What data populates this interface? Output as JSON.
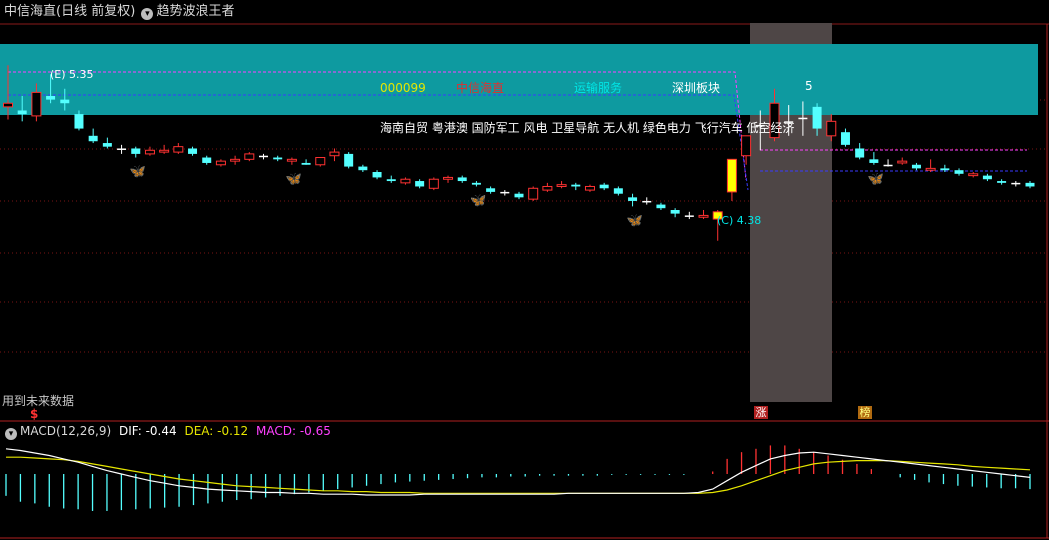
{
  "header": {
    "stock_name": "中信海直",
    "period_label": "(日线 前复权)",
    "indicator_label": "趋势波浪王者"
  },
  "banner": {
    "code": "000099",
    "name": "中信海直",
    "industry": "运输服务",
    "board": "深圳板块",
    "concepts": "海南自贸 粤港澳 国防军工 风电 卫星导航 无人机 绿色电力 飞行汽车 低空经济",
    "colors": {
      "bg": "#0e9aa0",
      "code": "#e6e600",
      "name": "#e03030",
      "industry": "#00e6e6",
      "board": "#ffffff"
    }
  },
  "annotations": {
    "high_label": "(E) 5.35",
    "low_label": "(C) 4.38",
    "peak_label": "5",
    "future_note": "用到未来数据",
    "marker_s": "$",
    "marker_zhang": "涨",
    "marker_bang": "榜"
  },
  "macd": {
    "label": "MACD(12,26,9)",
    "dif": "DIF: -0.44",
    "dea": "DEA: -0.12",
    "macd": "MACD: -0.65",
    "colors": {
      "dif": "#ffffff",
      "dea": "#e6e600",
      "macd": "#ff40ff"
    }
  },
  "chart_data": {
    "type": "candlestick",
    "price_range": [
      3.5,
      5.6
    ],
    "colors": {
      "up": "#ff3232",
      "down": "#54ffff",
      "doji": "#ffffff",
      "limit_up": "#ffff00"
    },
    "candles": [
      {
        "o": 5.12,
        "h": 5.35,
        "l": 5.05,
        "c": 5.14
      },
      {
        "o": 5.1,
        "h": 5.18,
        "l": 5.04,
        "c": 5.08
      },
      {
        "o": 5.07,
        "h": 5.25,
        "l": 5.04,
        "c": 5.2
      },
      {
        "o": 5.18,
        "h": 5.3,
        "l": 5.14,
        "c": 5.16
      },
      {
        "o": 5.16,
        "h": 5.22,
        "l": 5.1,
        "c": 5.14
      },
      {
        "o": 5.08,
        "h": 5.1,
        "l": 4.99,
        "c": 5.0
      },
      {
        "o": 4.96,
        "h": 5.0,
        "l": 4.92,
        "c": 4.93
      },
      {
        "o": 4.92,
        "h": 4.95,
        "l": 4.89,
        "c": 4.9
      },
      {
        "o": 4.89,
        "h": 4.91,
        "l": 4.86,
        "c": 4.89
      },
      {
        "o": 4.89,
        "h": 4.9,
        "l": 4.84,
        "c": 4.86
      },
      {
        "o": 4.86,
        "h": 4.9,
        "l": 4.85,
        "c": 4.88
      },
      {
        "o": 4.87,
        "h": 4.91,
        "l": 4.86,
        "c": 4.88
      },
      {
        "o": 4.87,
        "h": 4.92,
        "l": 4.86,
        "c": 4.9
      },
      {
        "o": 4.89,
        "h": 4.9,
        "l": 4.85,
        "c": 4.86
      },
      {
        "o": 4.84,
        "h": 4.85,
        "l": 4.8,
        "c": 4.81
      },
      {
        "o": 4.8,
        "h": 4.83,
        "l": 4.79,
        "c": 4.82
      },
      {
        "o": 4.82,
        "h": 4.85,
        "l": 4.8,
        "c": 4.83
      },
      {
        "o": 4.83,
        "h": 4.87,
        "l": 4.82,
        "c": 4.86
      },
      {
        "o": 4.85,
        "h": 4.86,
        "l": 4.83,
        "c": 4.85
      },
      {
        "o": 4.84,
        "h": 4.85,
        "l": 4.82,
        "c": 4.83
      },
      {
        "o": 4.82,
        "h": 4.84,
        "l": 4.8,
        "c": 4.83
      },
      {
        "o": 4.81,
        "h": 4.83,
        "l": 4.8,
        "c": 4.8
      },
      {
        "o": 4.8,
        "h": 4.84,
        "l": 4.79,
        "c": 4.84
      },
      {
        "o": 4.85,
        "h": 4.89,
        "l": 4.82,
        "c": 4.87
      },
      {
        "o": 4.86,
        "h": 4.87,
        "l": 4.78,
        "c": 4.79
      },
      {
        "o": 4.79,
        "h": 4.8,
        "l": 4.76,
        "c": 4.77
      },
      {
        "o": 4.76,
        "h": 4.77,
        "l": 4.72,
        "c": 4.73
      },
      {
        "o": 4.72,
        "h": 4.74,
        "l": 4.7,
        "c": 4.71
      },
      {
        "o": 4.7,
        "h": 4.73,
        "l": 4.69,
        "c": 4.72
      },
      {
        "o": 4.71,
        "h": 4.72,
        "l": 4.67,
        "c": 4.68
      },
      {
        "o": 4.67,
        "h": 4.73,
        "l": 4.66,
        "c": 4.72
      },
      {
        "o": 4.72,
        "h": 4.74,
        "l": 4.7,
        "c": 4.73
      },
      {
        "o": 4.73,
        "h": 4.74,
        "l": 4.7,
        "c": 4.71
      },
      {
        "o": 4.7,
        "h": 4.71,
        "l": 4.68,
        "c": 4.69
      },
      {
        "o": 4.67,
        "h": 4.68,
        "l": 4.64,
        "c": 4.65
      },
      {
        "o": 4.65,
        "h": 4.66,
        "l": 4.63,
        "c": 4.65
      },
      {
        "o": 4.64,
        "h": 4.65,
        "l": 4.61,
        "c": 4.62
      },
      {
        "o": 4.61,
        "h": 4.68,
        "l": 4.6,
        "c": 4.67
      },
      {
        "o": 4.66,
        "h": 4.7,
        "l": 4.65,
        "c": 4.68
      },
      {
        "o": 4.68,
        "h": 4.71,
        "l": 4.67,
        "c": 4.69
      },
      {
        "o": 4.69,
        "h": 4.7,
        "l": 4.66,
        "c": 4.68
      },
      {
        "o": 4.66,
        "h": 4.69,
        "l": 4.65,
        "c": 4.68
      },
      {
        "o": 4.69,
        "h": 4.7,
        "l": 4.66,
        "c": 4.67
      },
      {
        "o": 4.67,
        "h": 4.68,
        "l": 4.63,
        "c": 4.64
      },
      {
        "o": 4.62,
        "h": 4.64,
        "l": 4.57,
        "c": 4.6
      },
      {
        "o": 4.6,
        "h": 4.62,
        "l": 4.58,
        "c": 4.6
      },
      {
        "o": 4.58,
        "h": 4.59,
        "l": 4.55,
        "c": 4.56
      },
      {
        "o": 4.55,
        "h": 4.56,
        "l": 4.51,
        "c": 4.53
      },
      {
        "o": 4.52,
        "h": 4.54,
        "l": 4.5,
        "c": 4.52
      },
      {
        "o": 4.51,
        "h": 4.55,
        "l": 4.5,
        "c": 4.52
      },
      {
        "o": 4.5,
        "h": 4.55,
        "l": 4.38,
        "c": 4.54
      },
      {
        "o": 4.65,
        "h": 4.83,
        "l": 4.6,
        "c": 4.83
      },
      {
        "o": 4.85,
        "h": 4.96,
        "l": 4.8,
        "c": 4.96
      },
      {
        "o": 5.02,
        "h": 5.1,
        "l": 4.88,
        "c": 5.02
      },
      {
        "o": 4.95,
        "h": 5.22,
        "l": 4.93,
        "c": 5.14
      },
      {
        "o": 5.04,
        "h": 5.13,
        "l": 4.96,
        "c": 5.04
      },
      {
        "o": 5.06,
        "h": 5.15,
        "l": 4.96,
        "c": 5.06
      },
      {
        "o": 5.12,
        "h": 5.14,
        "l": 4.96,
        "c": 5.0
      },
      {
        "o": 4.96,
        "h": 5.08,
        "l": 4.93,
        "c": 5.04
      },
      {
        "o": 4.98,
        "h": 5.0,
        "l": 4.9,
        "c": 4.91
      },
      {
        "o": 4.89,
        "h": 4.92,
        "l": 4.83,
        "c": 4.84
      },
      {
        "o": 4.83,
        "h": 4.87,
        "l": 4.8,
        "c": 4.81
      },
      {
        "o": 4.8,
        "h": 4.83,
        "l": 4.79,
        "c": 4.8
      },
      {
        "o": 4.81,
        "h": 4.84,
        "l": 4.8,
        "c": 4.82
      },
      {
        "o": 4.8,
        "h": 4.81,
        "l": 4.77,
        "c": 4.78
      },
      {
        "o": 4.77,
        "h": 4.83,
        "l": 4.76,
        "c": 4.78
      },
      {
        "o": 4.78,
        "h": 4.8,
        "l": 4.76,
        "c": 4.77
      },
      {
        "o": 4.77,
        "h": 4.78,
        "l": 4.74,
        "c": 4.75
      },
      {
        "o": 4.74,
        "h": 4.76,
        "l": 4.73,
        "c": 4.75
      },
      {
        "o": 4.74,
        "h": 4.75,
        "l": 4.71,
        "c": 4.72
      },
      {
        "o": 4.71,
        "h": 4.72,
        "l": 4.69,
        "c": 4.7
      },
      {
        "o": 4.7,
        "h": 4.71,
        "l": 4.68,
        "c": 4.7
      },
      {
        "o": 4.7,
        "h": 4.71,
        "l": 4.67,
        "c": 4.68
      }
    ],
    "macd_range": [
      -0.75,
      0.5
    ],
    "macd_hist": [
      -0.26,
      -0.33,
      -0.35,
      -0.39,
      -0.41,
      -0.42,
      -0.44,
      -0.44,
      -0.43,
      -0.42,
      -0.41,
      -0.4,
      -0.39,
      -0.37,
      -0.35,
      -0.33,
      -0.31,
      -0.3,
      -0.28,
      -0.26,
      -0.24,
      -0.22,
      -0.2,
      -0.18,
      -0.16,
      -0.14,
      -0.12,
      -0.1,
      -0.09,
      -0.08,
      -0.07,
      -0.06,
      -0.05,
      -0.04,
      -0.04,
      -0.03,
      -0.03,
      -0.02,
      -0.02,
      -0.02,
      -0.02,
      -0.02,
      -0.01,
      -0.01,
      -0.01,
      -0.01,
      -0.01,
      -0.01,
      0.0,
      0.03,
      0.18,
      0.26,
      0.3,
      0.34,
      0.34,
      0.3,
      0.26,
      0.22,
      0.17,
      0.12,
      0.06,
      0.0,
      -0.04,
      -0.07,
      -0.1,
      -0.12,
      -0.14,
      -0.15,
      -0.16,
      -0.17,
      -0.17,
      -0.18
    ],
    "dif": [
      0.3,
      0.28,
      0.25,
      0.22,
      0.18,
      0.14,
      0.09,
      0.04,
      0.0,
      -0.04,
      -0.08,
      -0.11,
      -0.14,
      -0.16,
      -0.18,
      -0.19,
      -0.2,
      -0.21,
      -0.22,
      -0.22,
      -0.23,
      -0.23,
      -0.24,
      -0.24,
      -0.24,
      -0.25,
      -0.25,
      -0.25,
      -0.25,
      -0.24,
      -0.24,
      -0.24,
      -0.24,
      -0.24,
      -0.24,
      -0.24,
      -0.24,
      -0.24,
      -0.24,
      -0.23,
      -0.23,
      -0.23,
      -0.23,
      -0.23,
      -0.23,
      -0.23,
      -0.23,
      -0.23,
      -0.22,
      -0.18,
      -0.08,
      0.02,
      0.1,
      0.18,
      0.22,
      0.25,
      0.26,
      0.24,
      0.22,
      0.2,
      0.18,
      0.16,
      0.14,
      0.12,
      0.1,
      0.08,
      0.06,
      0.04,
      0.02,
      0.0,
      -0.02,
      -0.04
    ],
    "dea": [
      0.2,
      0.2,
      0.19,
      0.18,
      0.17,
      0.15,
      0.12,
      0.09,
      0.06,
      0.03,
      0.0,
      -0.03,
      -0.06,
      -0.08,
      -0.1,
      -0.12,
      -0.14,
      -0.15,
      -0.16,
      -0.17,
      -0.18,
      -0.19,
      -0.2,
      -0.2,
      -0.21,
      -0.21,
      -0.22,
      -0.22,
      -0.22,
      -0.23,
      -0.23,
      -0.23,
      -0.23,
      -0.23,
      -0.23,
      -0.23,
      -0.23,
      -0.23,
      -0.23,
      -0.23,
      -0.23,
      -0.23,
      -0.23,
      -0.23,
      -0.23,
      -0.23,
      -0.23,
      -0.23,
      -0.23,
      -0.22,
      -0.19,
      -0.14,
      -0.08,
      -0.02,
      0.04,
      0.08,
      0.12,
      0.14,
      0.15,
      0.16,
      0.16,
      0.16,
      0.15,
      0.14,
      0.13,
      0.12,
      0.11,
      0.09,
      0.08,
      0.07,
      0.06,
      0.05
    ]
  }
}
